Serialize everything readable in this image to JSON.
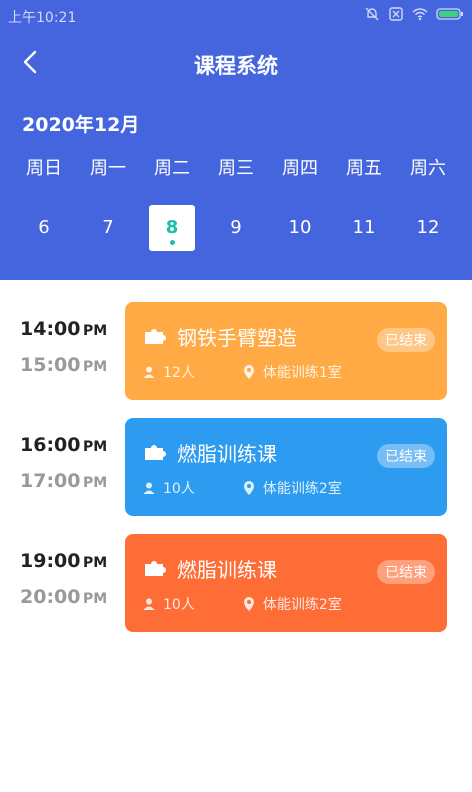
{
  "status": {
    "time": "上午10:21"
  },
  "header": {
    "title": "课程系统",
    "month": "2020年12月",
    "weekdays": [
      "周日",
      "周一",
      "周二",
      "周三",
      "周四",
      "周五",
      "周六"
    ],
    "dates": [
      "6",
      "7",
      "8",
      "9",
      "10",
      "11",
      "12"
    ],
    "selected_date": "8",
    "color": "#4565DF"
  },
  "courses": [
    {
      "start": "14:00",
      "start_ampm": "PM",
      "end": "15:00",
      "end_ampm": "PM",
      "title": "钢铁手臂塑造",
      "status": "已结束",
      "people": "12人",
      "location": "体能训练1室",
      "color": "#FFAA44"
    },
    {
      "start": "16:00",
      "start_ampm": "PM",
      "end": "17:00",
      "end_ampm": "PM",
      "title": "燃脂训练课",
      "status": "已结束",
      "people": "10人",
      "location": "体能训练2室",
      "color": "#2D9CF0"
    },
    {
      "start": "19:00",
      "start_ampm": "PM",
      "end": "20:00",
      "end_ampm": "PM",
      "title": "燃脂训练课",
      "status": "已结束",
      "people": "10人",
      "location": "体能训练2室",
      "color": "#FF6D36"
    }
  ]
}
